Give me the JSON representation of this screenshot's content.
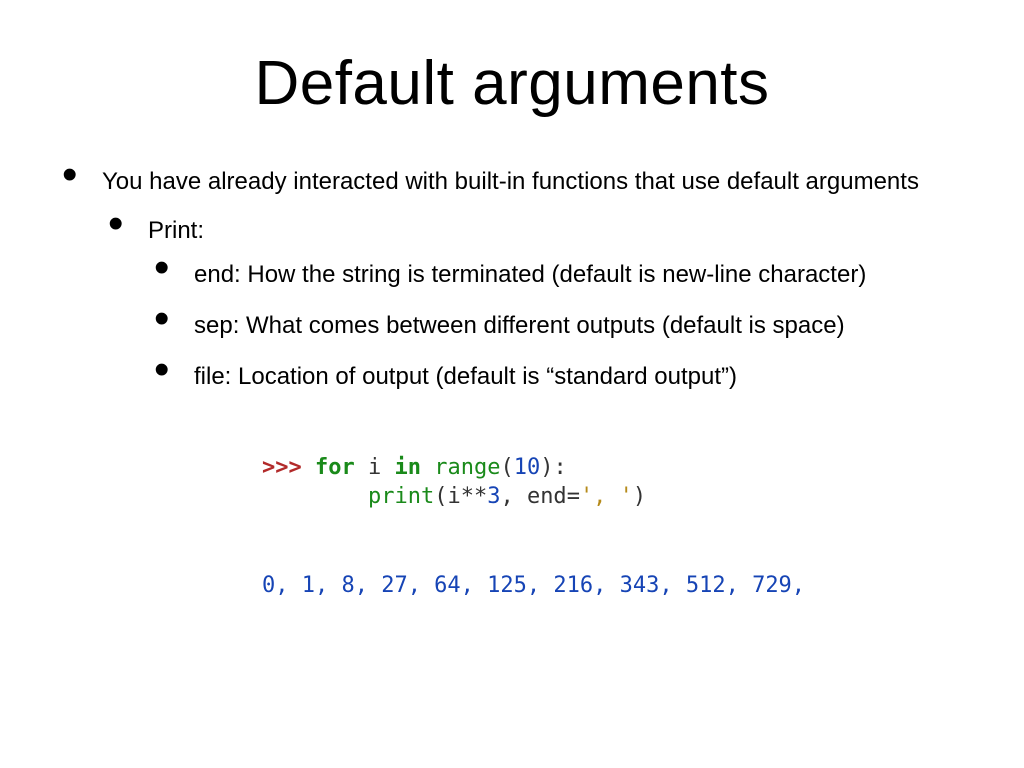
{
  "title": "Default arguments",
  "bullets": {
    "intro": "You have already interacted with built-in functions that use default arguments",
    "sub1": "Print:",
    "end": "end:  How the string is terminated (default is new-line character)",
    "sep": "sep:  What comes between different outputs (default is space)",
    "file": "file:  Location of output (default is “standard output”)"
  },
  "code": {
    "prompt": ">>> ",
    "kw_for": "for",
    "var_i": " i ",
    "kw_in": "in",
    "sp": " ",
    "fn_range": "range",
    "paren_open": "(",
    "num10": "10",
    "paren_close_colon": "):",
    "indent": "        ",
    "fn_print": "print",
    "arg_open": "(i",
    "op_pow": "**",
    "num3": "3",
    "comma_end": ", end",
    "eq": "=",
    "str_comma": "', '",
    "arg_close": ")",
    "output": "0, 1, 8, 27, 64, 125, 216, 343, 512, 729, "
  }
}
